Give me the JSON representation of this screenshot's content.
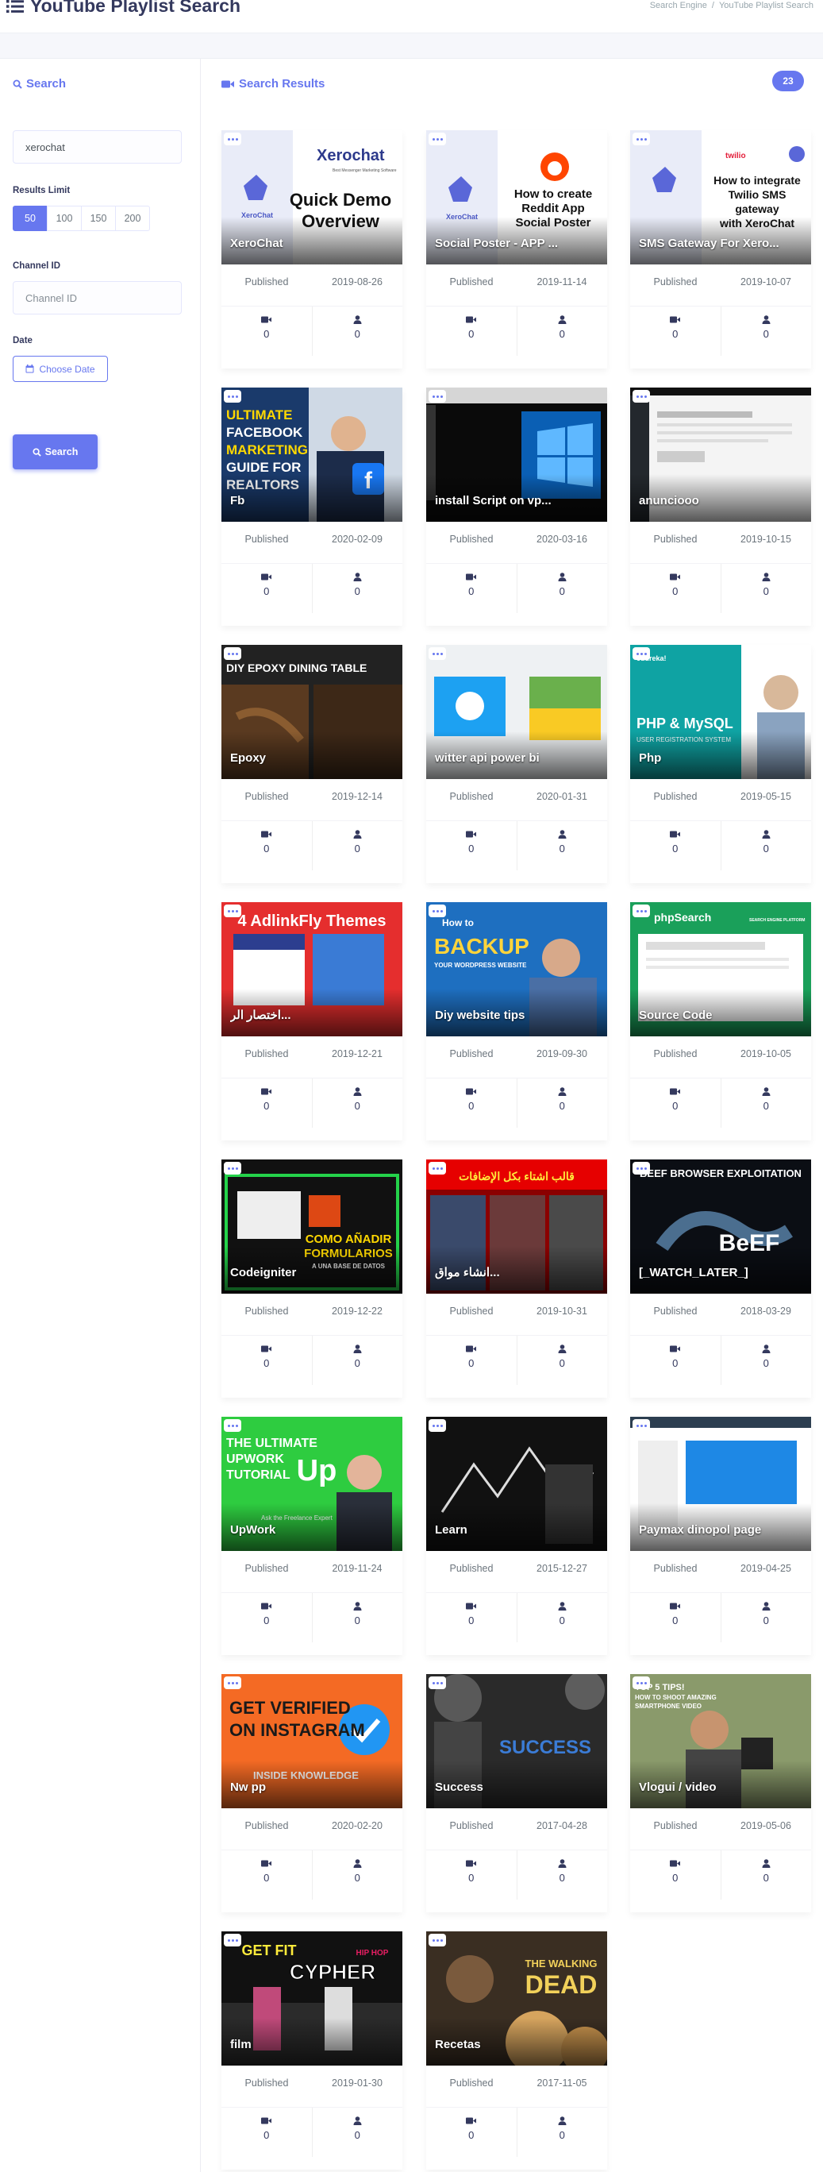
{
  "header": {
    "title": "YouTube Playlist Search",
    "breadcrumb": [
      "Search Engine",
      "YouTube Playlist Search"
    ]
  },
  "sidebar": {
    "heading": "Search",
    "keyword_value": "xerochat",
    "limit_label": "Results Limit",
    "limits": [
      "50",
      "100",
      "150",
      "200"
    ],
    "limit_selected": "50",
    "channel_label": "Channel ID",
    "channel_placeholder": "Channel ID",
    "date_label": "Date",
    "date_button": "Choose Date",
    "search_button": "Search"
  },
  "results": {
    "heading": "Search Results",
    "count": "23",
    "published_label": "Published",
    "cards": [
      {
        "title": "XeroChat",
        "date": "2019-08-26",
        "videos": "0",
        "subs": "0",
        "theme": "xero1"
      },
      {
        "title": "Social Poster - APP ...",
        "date": "2019-11-14",
        "videos": "0",
        "subs": "0",
        "theme": "xero2"
      },
      {
        "title": "SMS Gateway For Xero...",
        "date": "2019-10-07",
        "videos": "0",
        "subs": "0",
        "theme": "xero3"
      },
      {
        "title": "Fb",
        "date": "2020-02-09",
        "videos": "0",
        "subs": "0",
        "theme": "fb"
      },
      {
        "title": "install Script on vp...",
        "date": "2020-03-16",
        "videos": "0",
        "subs": "0",
        "theme": "win"
      },
      {
        "title": "anunciooo",
        "date": "2019-10-15",
        "videos": "0",
        "subs": "0",
        "theme": "admin"
      },
      {
        "title": "Epoxy",
        "date": "2019-12-14",
        "videos": "0",
        "subs": "0",
        "theme": "epoxy"
      },
      {
        "title": "witter api power bi",
        "date": "2020-01-31",
        "videos": "0",
        "subs": "0",
        "theme": "twitter"
      },
      {
        "title": "Php",
        "date": "2019-05-15",
        "videos": "0",
        "subs": "0",
        "theme": "php"
      },
      {
        "title": "اختصار الر...",
        "date": "2019-12-21",
        "videos": "0",
        "subs": "0",
        "theme": "adlink"
      },
      {
        "title": "Diy website tips",
        "date": "2019-09-30",
        "videos": "0",
        "subs": "0",
        "theme": "backup"
      },
      {
        "title": "Source Code",
        "date": "2019-10-05",
        "videos": "0",
        "subs": "0",
        "theme": "phpsearch"
      },
      {
        "title": "Codeigniter",
        "date": "2019-12-22",
        "videos": "0",
        "subs": "0",
        "theme": "codeigniter"
      },
      {
        "title": "انشاء مواق...",
        "date": "2019-10-31",
        "videos": "0",
        "subs": "0",
        "theme": "arabic"
      },
      {
        "title": "[_WATCH_LATER_]",
        "date": "2018-03-29",
        "videos": "0",
        "subs": "0",
        "theme": "beef"
      },
      {
        "title": "UpWork",
        "date": "2019-11-24",
        "videos": "0",
        "subs": "0",
        "theme": "upwork"
      },
      {
        "title": "Learn",
        "date": "2015-12-27",
        "videos": "0",
        "subs": "0",
        "theme": "learn"
      },
      {
        "title": "Paymax dinopol page",
        "date": "2019-04-25",
        "videos": "0",
        "subs": "0",
        "theme": "paymax"
      },
      {
        "title": "Nw pp",
        "date": "2020-02-20",
        "videos": "0",
        "subs": "0",
        "theme": "insta"
      },
      {
        "title": "Success",
        "date": "2017-04-28",
        "videos": "0",
        "subs": "0",
        "theme": "success"
      },
      {
        "title": "Vlogui / video",
        "date": "2019-05-06",
        "videos": "0",
        "subs": "0",
        "theme": "vlog"
      },
      {
        "title": "film",
        "date": "2019-01-30",
        "videos": "0",
        "subs": "0",
        "theme": "cypher"
      },
      {
        "title": "Recetas",
        "date": "2017-11-05",
        "videos": "0",
        "subs": "0",
        "theme": "walkingdead"
      }
    ]
  },
  "thumb_text": {
    "xero1": [
      "Quick Demo",
      "Overview",
      "Xerochat",
      "Best Messenger Marketing Software",
      "XeroChat"
    ],
    "xero2": [
      "How to create",
      "Reddit App",
      "Social Poster",
      "XeroChat"
    ],
    "xero3": [
      "How to integrate",
      "Twilio SMS",
      "gateway",
      "with XeroChat",
      "twilio"
    ],
    "fb": [
      "ULTIMATE",
      "FACEBOOK",
      "MARKETING",
      "GUIDE FOR",
      "REALTORS",
      "f"
    ],
    "epoxy": [
      "DIY EPOXY DINING TABLE"
    ],
    "php": [
      "PHP & MySQL",
      "USER REGISTRATION SYSTEM",
      "edureka!"
    ],
    "adlink": [
      "4 AdlinkFly Themes"
    ],
    "backup": [
      "How to",
      "BACKUP",
      "YOUR WORDPRESS WEBSITE"
    ],
    "phpsearch": [
      "phpSearch",
      "SEARCH ENGINE PLATFORM"
    ],
    "codeigniter": [
      "COMO AÑADIR",
      "FORMULARIOS",
      "A UNA BASE DE DATOS"
    ],
    "arabic": [
      "قالب اشتاء بكل الإضافات"
    ],
    "beef": [
      "BEEF BROWSER EXPLOITATION",
      "BeEF"
    ],
    "upwork": [
      "THE ULTIMATE",
      "UPWORK",
      "TUTORIAL",
      "Up",
      "Ask the Freelance Expert"
    ],
    "insta": [
      "GET VERIFIED",
      "ON INSTAGRAM",
      "INSIDE KNOWLEDGE"
    ],
    "success": [
      "SUCCESS"
    ],
    "vlog": [
      "TOP 5 TIPS!",
      "HOW TO SHOOT AMAZING",
      "SMARTPHONE VIDEO"
    ],
    "cypher": [
      "GET FIT",
      "CYPHER",
      "HIP HOP"
    ],
    "walkingdead": [
      "THE WALKING",
      "DEAD"
    ]
  },
  "colors": {
    "accent": "#6777ef",
    "text": "#34395e",
    "muted": "#6c757d"
  }
}
